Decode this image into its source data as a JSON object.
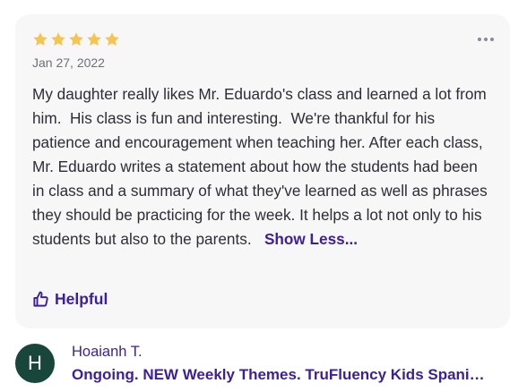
{
  "review": {
    "rating": 5,
    "rating_max": 5,
    "star_color": "#f5c451",
    "date": "Jan 27, 2022",
    "more_icon": "more-horizontal-icon",
    "text": "My daughter really likes Mr. Eduardo's class and learned a lot from him.  His class is fun and interesting.  We're thankful for his patience and encouragement when teaching her. After each class, Mr. Eduardo writes a statement about how the students had been in class and a summary of what they've learned as well as phrases they should be practicing for the week. It helps a lot not only to his students but also to the parents.   ",
    "show_less_label": "Show Less...",
    "helpful_label": "Helpful",
    "helpful_icon": "thumbs-up-icon"
  },
  "reviewer": {
    "avatar_initial": "H",
    "avatar_color": "#18463a",
    "name": "Hoaianh T.",
    "class_title": "Ongoing. NEW Weekly Themes. TruFluency Kids Spanish Immersion"
  },
  "accent_color": "#3c1f9a"
}
